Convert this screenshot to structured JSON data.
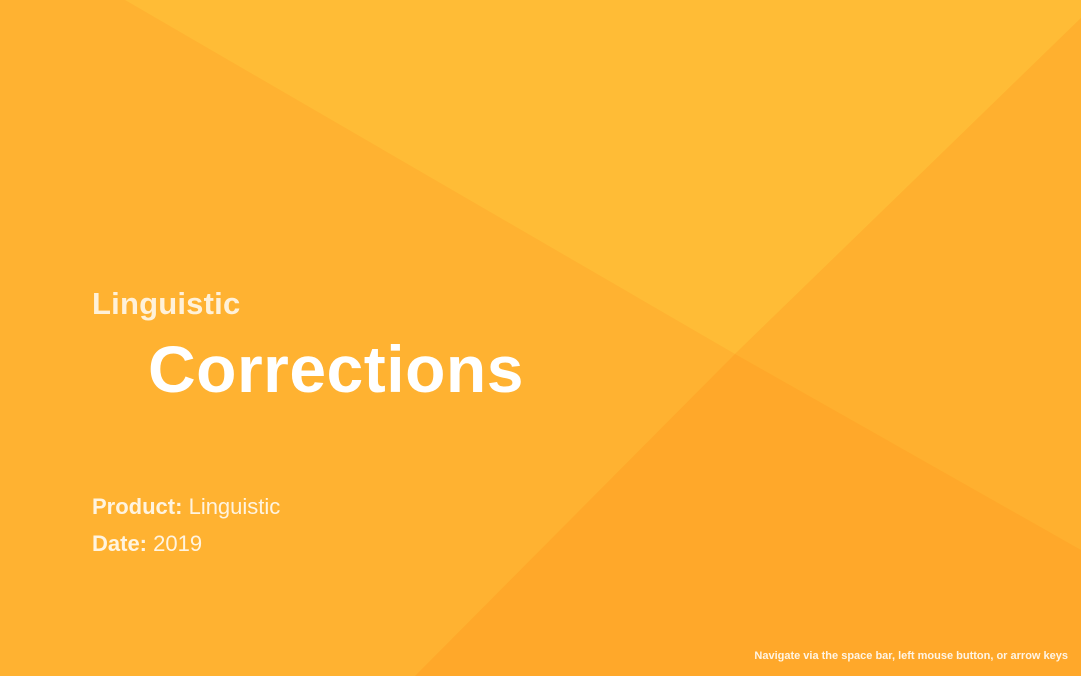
{
  "theme": {
    "background": "#FFB231",
    "facet_light": "#FFBC36",
    "facet_mid": "#FFB02F",
    "facet_dark": "#FFA82A",
    "text": "#FFFFFF"
  },
  "slide": {
    "kicker": "Linguistic",
    "title": "Corrections",
    "meta": {
      "product_label": "Product:",
      "product_value": "Linguistic",
      "date_label": "Date:",
      "date_value": "2019"
    },
    "navigation_hint": "Navigate via the space bar, left mouse button, or arrow keys"
  }
}
